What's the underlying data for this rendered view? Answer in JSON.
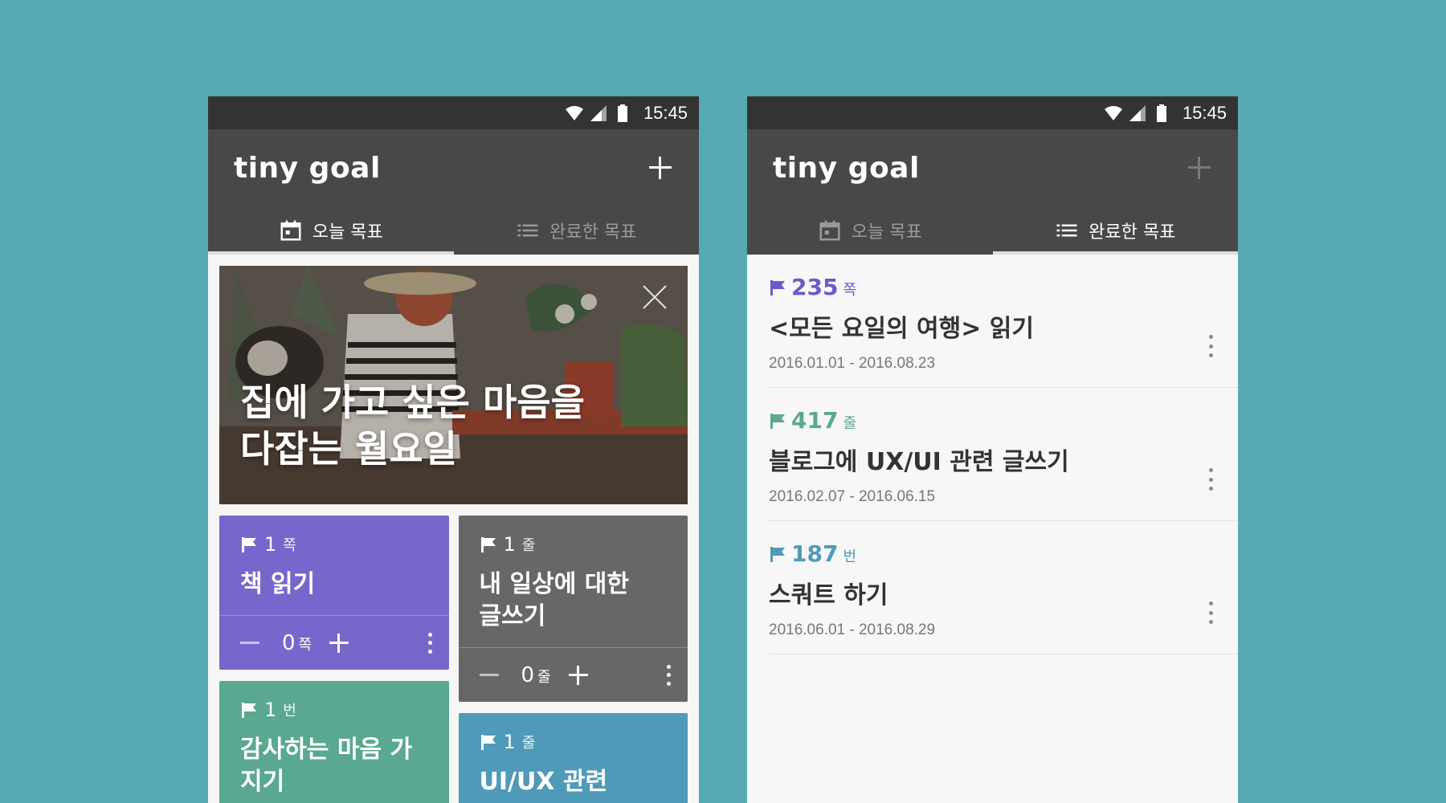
{
  "colors": {
    "background": "#56a9b5",
    "status_bar": "#333333",
    "app_bar": "#484848",
    "card_purple": "#7966cc",
    "card_gray": "#676767",
    "card_green": "#5aa891",
    "card_blue": "#4f9ab8",
    "done_purple": "#7058c8",
    "done_green": "#5aa891",
    "done_blue": "#4f9ab8"
  },
  "status_bar": {
    "time": "15:45",
    "icons": [
      "wifi-icon",
      "signal-icon",
      "battery-icon"
    ]
  },
  "app": {
    "title": "tiny goal"
  },
  "tabs": [
    {
      "label": "오늘 목표",
      "icon": "calendar-icon"
    },
    {
      "label": "완료한 목표",
      "icon": "list-icon"
    }
  ],
  "today": {
    "hero": {
      "line1": "집에 가고 싶은 마음을",
      "line2": "다잡는 월요일"
    },
    "cards": [
      {
        "target_value": "1",
        "target_unit": "쪽",
        "name": "책 읽기",
        "count": "0",
        "count_unit": "쪽"
      },
      {
        "target_value": "1",
        "target_unit": "줄",
        "name": "내 일상에 대한 글쓰기",
        "count": "0",
        "count_unit": "줄"
      },
      {
        "target_value": "1",
        "target_unit": "번",
        "name": "감사하는 마음 가지기"
      },
      {
        "target_value": "1",
        "target_unit": "줄",
        "name": "UI/UX 관련"
      }
    ]
  },
  "done": {
    "items": [
      {
        "target_value": "235",
        "target_unit": "쪽",
        "name": "<모든 요일의 여행> 읽기",
        "dates": "2016.01.01 - 2016.08.23"
      },
      {
        "target_value": "417",
        "target_unit": "줄",
        "name": "블로그에 UX/UI 관련 글쓰기",
        "dates": "2016.02.07 - 2016.06.15"
      },
      {
        "target_value": "187",
        "target_unit": "번",
        "name": "스쿼트 하기",
        "dates": "2016.06.01 - 2016.08.29"
      }
    ]
  }
}
